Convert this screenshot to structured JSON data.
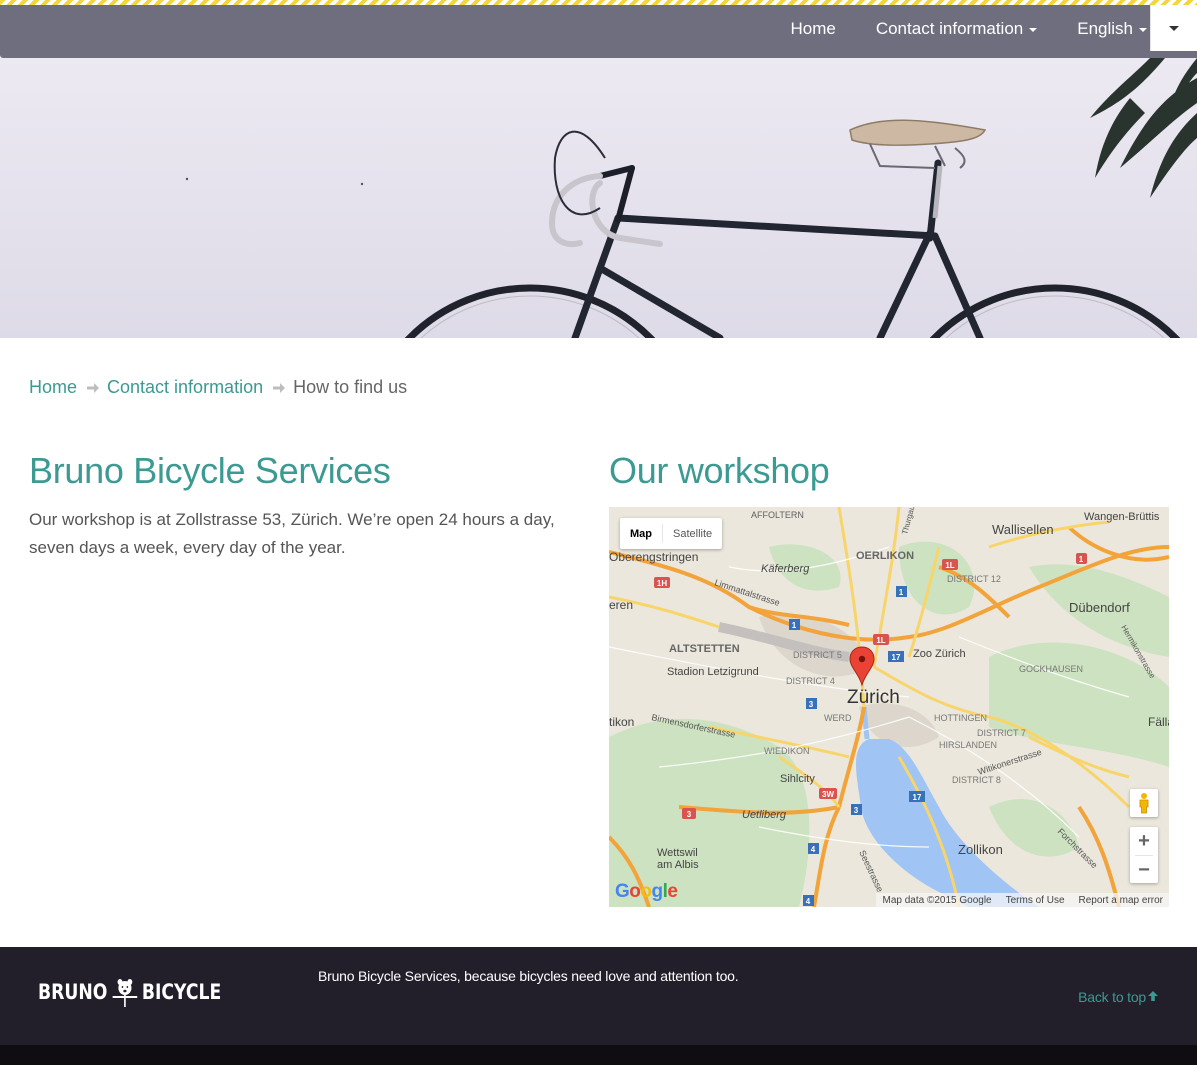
{
  "nav": {
    "items": [
      {
        "label": "Home",
        "dropdown": false
      },
      {
        "label": "Contact information",
        "dropdown": true
      },
      {
        "label": "English",
        "dropdown": true
      }
    ],
    "toggle_icon": "caret-down-icon"
  },
  "hero": {
    "image": "bicycle-against-wall"
  },
  "breadcrumb": {
    "home": "Home",
    "contact": "Contact information",
    "current": "How to find us"
  },
  "main": {
    "title": "Bruno Bicycle Services",
    "description": "Our workshop is at Zollstrasse 53, Zürich. We’re open 24 hours a day, seven days a week, every day of the year."
  },
  "workshop": {
    "title": "Our workshop",
    "map": {
      "type_map": "Map",
      "type_satellite": "Satellite",
      "city_label": "Zürich",
      "labels": {
        "affoltern": "AFFOLTERN",
        "wallisellen": "Wallisellen",
        "wangen": "Wangen-Brüttis",
        "oberengstringen": "Oberengstringen",
        "oerlikon": "OERLIKON",
        "kaferberg": "Käferberg",
        "district12": "DISTRICT 12",
        "dubendorf": "Dübendorf",
        "eren": "eren",
        "limmattalstrasse": "Limmattalstrasse",
        "altstetten": "ALTSTETTEN",
        "district5": "DISTRICT 5",
        "zoo": "Zoo Zürich",
        "gockhausen": "GOCKHAUSEN",
        "stadion": "Stadion Letzigrund",
        "district4": "DISTRICT 4",
        "tikon": "tikon",
        "werd": "WERD",
        "hottingen": "HOTTINGEN",
        "district7": "DISTRICT 7",
        "hirslanden": "HIRSLANDEN",
        "falland": "Fällan",
        "birmensdorferstrasse": "Birmensdorferstrasse",
        "wiedikon": "WIEDIKON",
        "witikonerstrasse": "Witikonerstrasse",
        "sihlcity": "Sihlcity",
        "district8": "DISTRICT 8",
        "uetliberg": "Uetliberg",
        "wettswil1": "Wettswil",
        "wettswil2": "am Albis",
        "zollikon": "Zollikon",
        "seestrasse": "Seestrasse",
        "forchstrasse": "Forchstrasse",
        "hermikonstrasse": "Hermikonstrasse",
        "thurgauerstrasse": "Thurgauerstr."
      },
      "road_badges": [
        "1H",
        "1L",
        "1L",
        "1",
        "1",
        "1",
        "17",
        "17",
        "3",
        "3",
        "3",
        "3W",
        "4",
        "4"
      ],
      "google": "Google",
      "attribution": "Map data ©2015 Google",
      "terms": "Terms of Use",
      "report": "Report a map error",
      "zoom_in": "+",
      "zoom_out": "−"
    }
  },
  "footer": {
    "logo_left": "BRUNO",
    "logo_right": "BICYCLE",
    "tagline": "Bruno Bicycle Services, because bicycles need love and attention too.",
    "back_to_top": "Back to top"
  },
  "colors": {
    "accent": "#3b9a92",
    "navbar": "#6e6e7e",
    "footer": "#231f2a",
    "stripe": "#f2d63a"
  }
}
